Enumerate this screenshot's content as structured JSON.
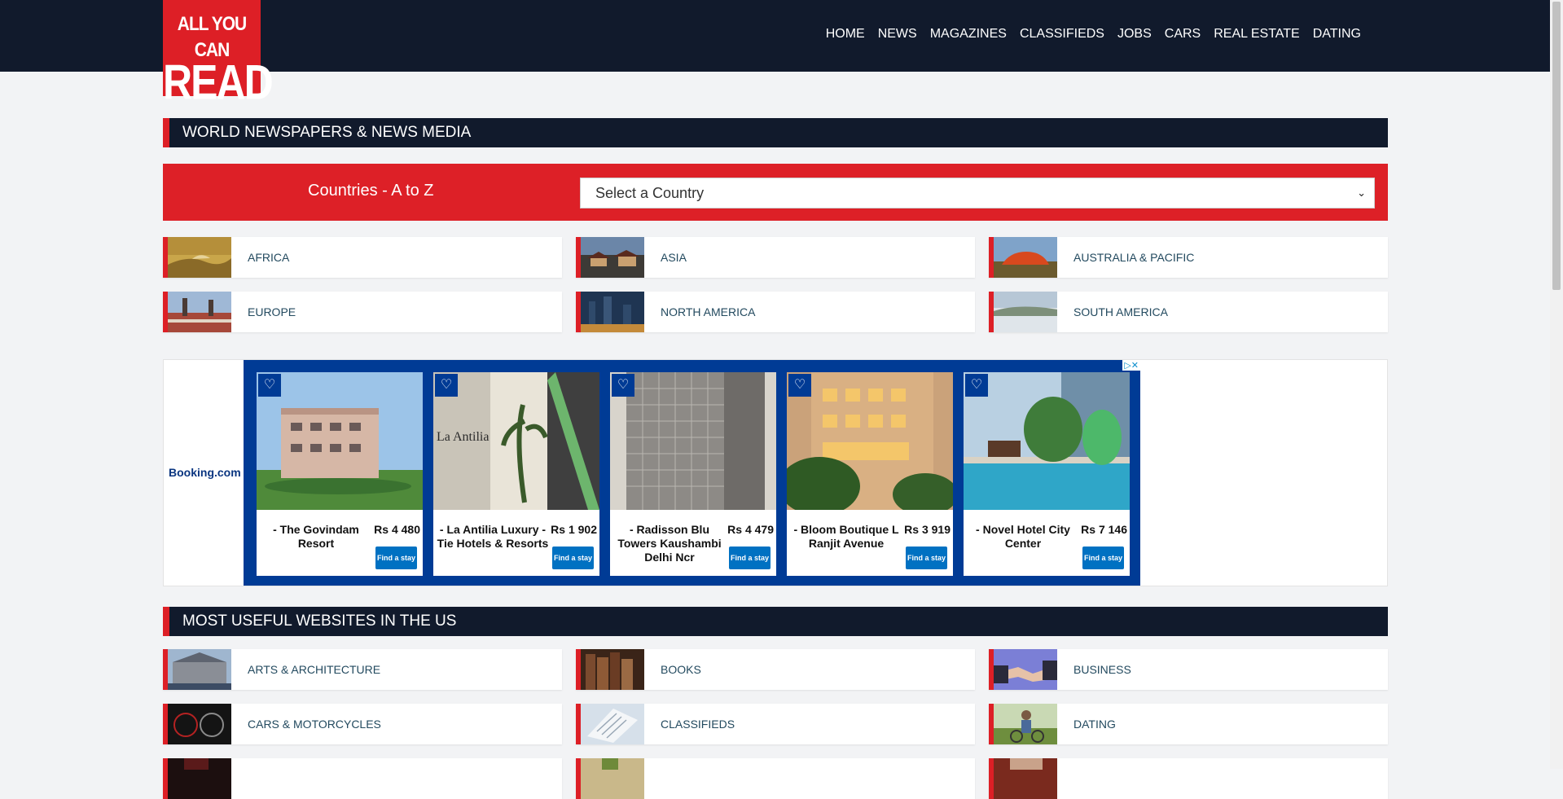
{
  "logo": {
    "line1": "ALL YOU CAN",
    "line2": "READ"
  },
  "nav": [
    "HOME",
    "NEWS",
    "MAGAZINES",
    "CLASSIFIEDS",
    "JOBS",
    "CARS",
    "REAL ESTATE",
    "DATING"
  ],
  "sections": {
    "world_title": "WORLD NEWSPAPERS & NEWS MEDIA",
    "useful_title": "MOST USEFUL WEBSITES IN THE US"
  },
  "countries": {
    "label": "Countries - A to Z",
    "select_value": "Select a Country"
  },
  "regions": [
    {
      "label": "AFRICA"
    },
    {
      "label": "ASIA"
    },
    {
      "label": "AUSTRALIA & PACIFIC"
    },
    {
      "label": "EUROPE"
    },
    {
      "label": "NORTH AMERICA"
    },
    {
      "label": "SOUTH AMERICA"
    }
  ],
  "ad": {
    "brand": "Booking.com",
    "hotels": [
      {
        "name": "- The Govindam Resort",
        "price": "Rs 4 480",
        "cta": "Find a stay"
      },
      {
        "name": "- La Antilia Luxury - Tie Hotels & Resorts",
        "price": "Rs 1 902",
        "cta": "Find a stay"
      },
      {
        "name": "- Radisson Blu Towers Kaushambi Delhi Ncr",
        "price": "Rs 4 479",
        "cta": "Find a stay"
      },
      {
        "name": "- Bloom Boutique L Ranjit Avenue",
        "price": "Rs 3 919",
        "cta": "Find a stay"
      },
      {
        "name": "- Novel Hotel City Center",
        "price": "Rs 7 146",
        "cta": "Find a stay"
      }
    ]
  },
  "useful": [
    {
      "label": "ARTS & ARCHITECTURE"
    },
    {
      "label": "BOOKS"
    },
    {
      "label": "BUSINESS"
    },
    {
      "label": "CARS & MOTORCYCLES"
    },
    {
      "label": "CLASSIFIEDS"
    },
    {
      "label": "DATING"
    }
  ]
}
